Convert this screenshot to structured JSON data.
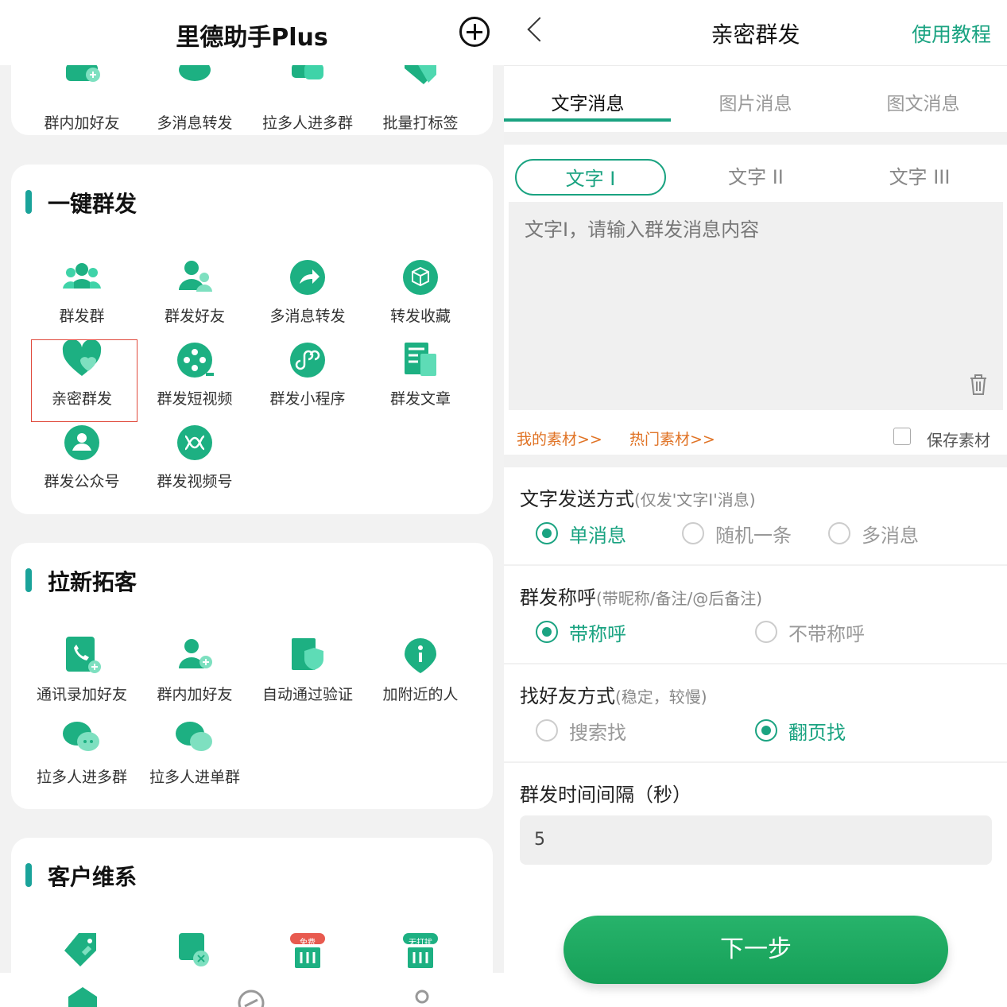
{
  "left": {
    "app_title": "里德助手Plus",
    "top_row": [
      {
        "label": "群内加好友"
      },
      {
        "label": "多消息转发"
      },
      {
        "label": "拉多人进多群"
      },
      {
        "label": "批量打标签"
      }
    ],
    "sec1": {
      "title": "一键群发",
      "items": [
        {
          "label": "群发群",
          "icon": "group-icon"
        },
        {
          "label": "群发好友",
          "icon": "friends-icon"
        },
        {
          "label": "多消息转发",
          "icon": "forward-icon"
        },
        {
          "label": "转发收藏",
          "icon": "box-icon"
        },
        {
          "label": "亲密群发",
          "icon": "heart-icon"
        },
        {
          "label": "群发短视频",
          "icon": "film-icon"
        },
        {
          "label": "群发小程序",
          "icon": "miniprogram-icon"
        },
        {
          "label": "群发文章",
          "icon": "article-icon"
        },
        {
          "label": "群发公众号",
          "icon": "official-account-icon"
        },
        {
          "label": "群发视频号",
          "icon": "channels-icon"
        }
      ]
    },
    "sec2": {
      "title": "拉新拓客",
      "items": [
        {
          "label": "通讯录加好友",
          "icon": "contacts-add-icon"
        },
        {
          "label": "群内加好友",
          "icon": "user-add-icon"
        },
        {
          "label": "自动通过验证",
          "icon": "shield-icon"
        },
        {
          "label": "加附近的人",
          "icon": "location-icon"
        },
        {
          "label": "拉多人进多群",
          "icon": "chat-bubbles-icon"
        },
        {
          "label": "拉多人进单群",
          "icon": "chat-bubble-icon"
        }
      ]
    },
    "sec3": {
      "title": "客户维系",
      "badges": [
        "免费",
        "无打扰"
      ]
    }
  },
  "right": {
    "title": "亲密群发",
    "tutorial": "使用教程",
    "tabs": [
      "文字消息",
      "图片消息",
      "图文消息"
    ],
    "subtabs": [
      "文字 I",
      "文字 II",
      "文字 III"
    ],
    "textarea_placeholder": "文字I，请输入群发消息内容",
    "my_materials": "我的素材>>",
    "hot_materials": "热门素材>>",
    "save_material": "保存素材",
    "send_mode": {
      "title": "文字发送方式",
      "hint": "(仅发'文字I'消息)",
      "options": [
        "单消息",
        "随机一条",
        "多消息"
      ],
      "selected": "单消息"
    },
    "salutation": {
      "title": "群发称呼",
      "hint": "(带昵称/备注/@后备注)",
      "options": [
        "带称呼",
        "不带称呼"
      ],
      "selected": "带称呼"
    },
    "find_mode": {
      "title": "找好友方式",
      "hint": "(稳定，较慢)",
      "options": [
        "搜索找",
        "翻页找"
      ],
      "selected": "翻页找"
    },
    "interval": {
      "title": "群发时间间隔（秒）",
      "value": "5"
    },
    "next_button": "下一步"
  },
  "colors": {
    "accent": "#1aa381",
    "teal": "#1aa39a",
    "orange": "#e07325",
    "highlight_border": "#e04a3c"
  }
}
